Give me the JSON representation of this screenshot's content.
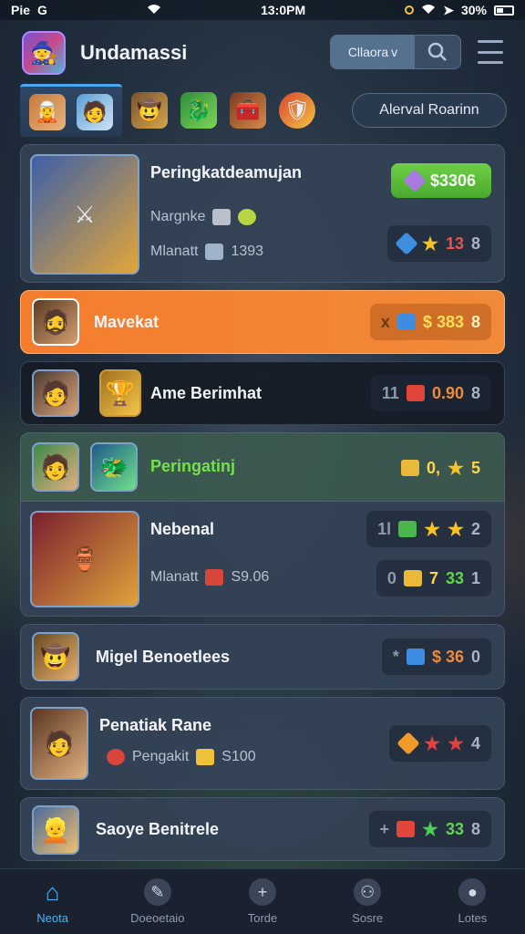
{
  "status_bar": {
    "left": "Pie",
    "left2": "G",
    "time": "13:0PM",
    "battery": "30%"
  },
  "header": {
    "title": "Undamassi",
    "filter_label": "Cllaora",
    "filter_arrow": "v"
  },
  "categories": {
    "ranking_button": "Alerval Roarinn"
  },
  "rows": [
    {
      "title": "Peringkatdeamujan",
      "sub1": "Nargnke",
      "sub2_label": "Mlanatt",
      "sub2_value": "1393",
      "price": "$3306",
      "stat_a": "13",
      "stat_b": "8"
    },
    {
      "title": "Mavekat",
      "x": "x",
      "value": "$ 383",
      "count": "8"
    },
    {
      "title": "Ame Berimhat",
      "left": "11",
      "value": "0.90",
      "count": "8"
    },
    {
      "title": "Peringatinj",
      "value": "0,",
      "count": "5"
    },
    {
      "title": "Nebenal",
      "left": "1l",
      "count": "2",
      "sub_label": "Mlanatt",
      "sub_value": "S9.06",
      "left2": "0",
      "value2": "7",
      "value3": "33",
      "count2": "1"
    },
    {
      "title": "Migel Benoetlees",
      "x": "*",
      "value": "$ 36",
      "count": "0"
    },
    {
      "title": "Penatiak Rane",
      "sub_label": "Pengakit",
      "sub_value": "S100",
      "count": "4"
    },
    {
      "title": "Saoye Benitrele",
      "x": "+",
      "value": "33",
      "count": "8"
    }
  ],
  "nav": [
    {
      "label": "Neota",
      "icon": "home-icon"
    },
    {
      "label": "Doeoetaio",
      "icon": "compass-icon"
    },
    {
      "label": "Torde",
      "icon": "plus-icon"
    },
    {
      "label": "Sosre",
      "icon": "people-icon"
    },
    {
      "label": "Lotes",
      "icon": "user-icon"
    }
  ],
  "colors": {
    "accent": "#4fb5f5",
    "orange": "#f47d2d",
    "green": "#5cc63a"
  }
}
